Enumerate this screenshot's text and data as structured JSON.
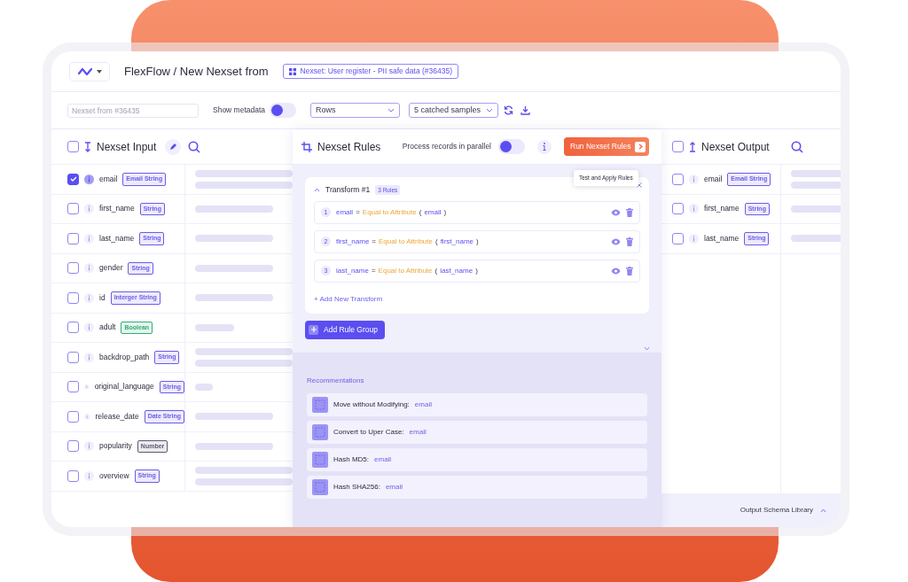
{
  "header": {
    "title": "FlexFlow / New Nexset from",
    "source_chip": "Nexset: User register - PII safe data (#36435)"
  },
  "toolbar": {
    "name_field": {
      "placeholder": "Nexset from #36435"
    },
    "show_metadata": {
      "label": "Show metadata",
      "on": false
    },
    "rows_select": "Rows",
    "samples_select": "5 catched samples"
  },
  "input_panel": {
    "title": "Nexset Input",
    "select_all": false,
    "fields": [
      {
        "name": "email",
        "type": "Email String",
        "color": "#6c5ce7",
        "checked": true,
        "kind": "double"
      },
      {
        "name": "first_name",
        "type": "String",
        "color": "#6c5ce7",
        "checked": false,
        "kind": "single"
      },
      {
        "name": "last_name",
        "type": "String",
        "color": "#6c5ce7",
        "checked": false,
        "kind": "single"
      },
      {
        "name": "gender",
        "type": "String",
        "color": "#6c5ce7",
        "checked": false,
        "kind": "single"
      },
      {
        "name": "id",
        "type": "Interger String",
        "color": "#6c5ce7",
        "checked": false,
        "kind": "single"
      },
      {
        "name": "adult",
        "type": "Boolean",
        "color": "#2fae74",
        "checked": false,
        "kind": "short"
      },
      {
        "name": "backdrop_path",
        "type": "String",
        "color": "#6c5ce7",
        "checked": false,
        "kind": "double"
      },
      {
        "name": "original_language",
        "type": "String",
        "color": "#6c5ce7",
        "checked": false,
        "kind": "tiny"
      },
      {
        "name": "release_date",
        "type": "Date String",
        "color": "#6c5ce7",
        "checked": false,
        "kind": "single"
      },
      {
        "name": "popularity",
        "type": "Number",
        "color": "#5c5a72",
        "checked": false,
        "kind": "single"
      },
      {
        "name": "overview",
        "type": "String",
        "color": "#6c5ce7",
        "checked": false,
        "kind": "double"
      }
    ]
  },
  "rules_panel": {
    "title": "Nexset Rules",
    "parallel": {
      "label": "Process records in parallel",
      "on": false
    },
    "run_button": "Run Nexset Rules",
    "tooltip": "Test and Apply Rules",
    "transform": {
      "title": "Transform #1",
      "badge": "3 Rules",
      "expanded": true,
      "rules": [
        {
          "number": "1",
          "target": "email",
          "operator": "=",
          "function": "Equal to Attribute",
          "open": "(",
          "argument": "email",
          "close": ")"
        },
        {
          "number": "2",
          "target": "first_name",
          "operator": "=",
          "function": "Equal to Attribute",
          "open": "(",
          "argument": "first_name",
          "close": ")"
        },
        {
          "number": "3",
          "target": "last_name",
          "operator": "=",
          "function": "Equal to Attribute",
          "open": "(",
          "argument": "last_name",
          "close": ")"
        }
      ],
      "add_link": "+ Add New Transform"
    },
    "add_group_button": "Add Rule Group",
    "recommendations": {
      "title": "Recommentations",
      "items": [
        {
          "text": "Move without Modifying:",
          "field": "email"
        },
        {
          "text": "Convert to Uper Case:",
          "field": "email"
        },
        {
          "text": "Hash MD5:",
          "field": "email"
        },
        {
          "text": "Hash SHA256:",
          "field": "email"
        }
      ]
    }
  },
  "output_panel": {
    "title": "Nexset Output",
    "select_all": false,
    "fields": [
      {
        "name": "email",
        "type": "Email String",
        "color": "#6c5ce7",
        "checked": false,
        "kind": "double"
      },
      {
        "name": "first_name",
        "type": "String",
        "color": "#6c5ce7",
        "checked": false,
        "kind": "single"
      },
      {
        "name": "last_name",
        "type": "String",
        "color": "#6c5ce7",
        "checked": false,
        "kind": "single"
      }
    ],
    "footer": "Output Schema Library"
  }
}
